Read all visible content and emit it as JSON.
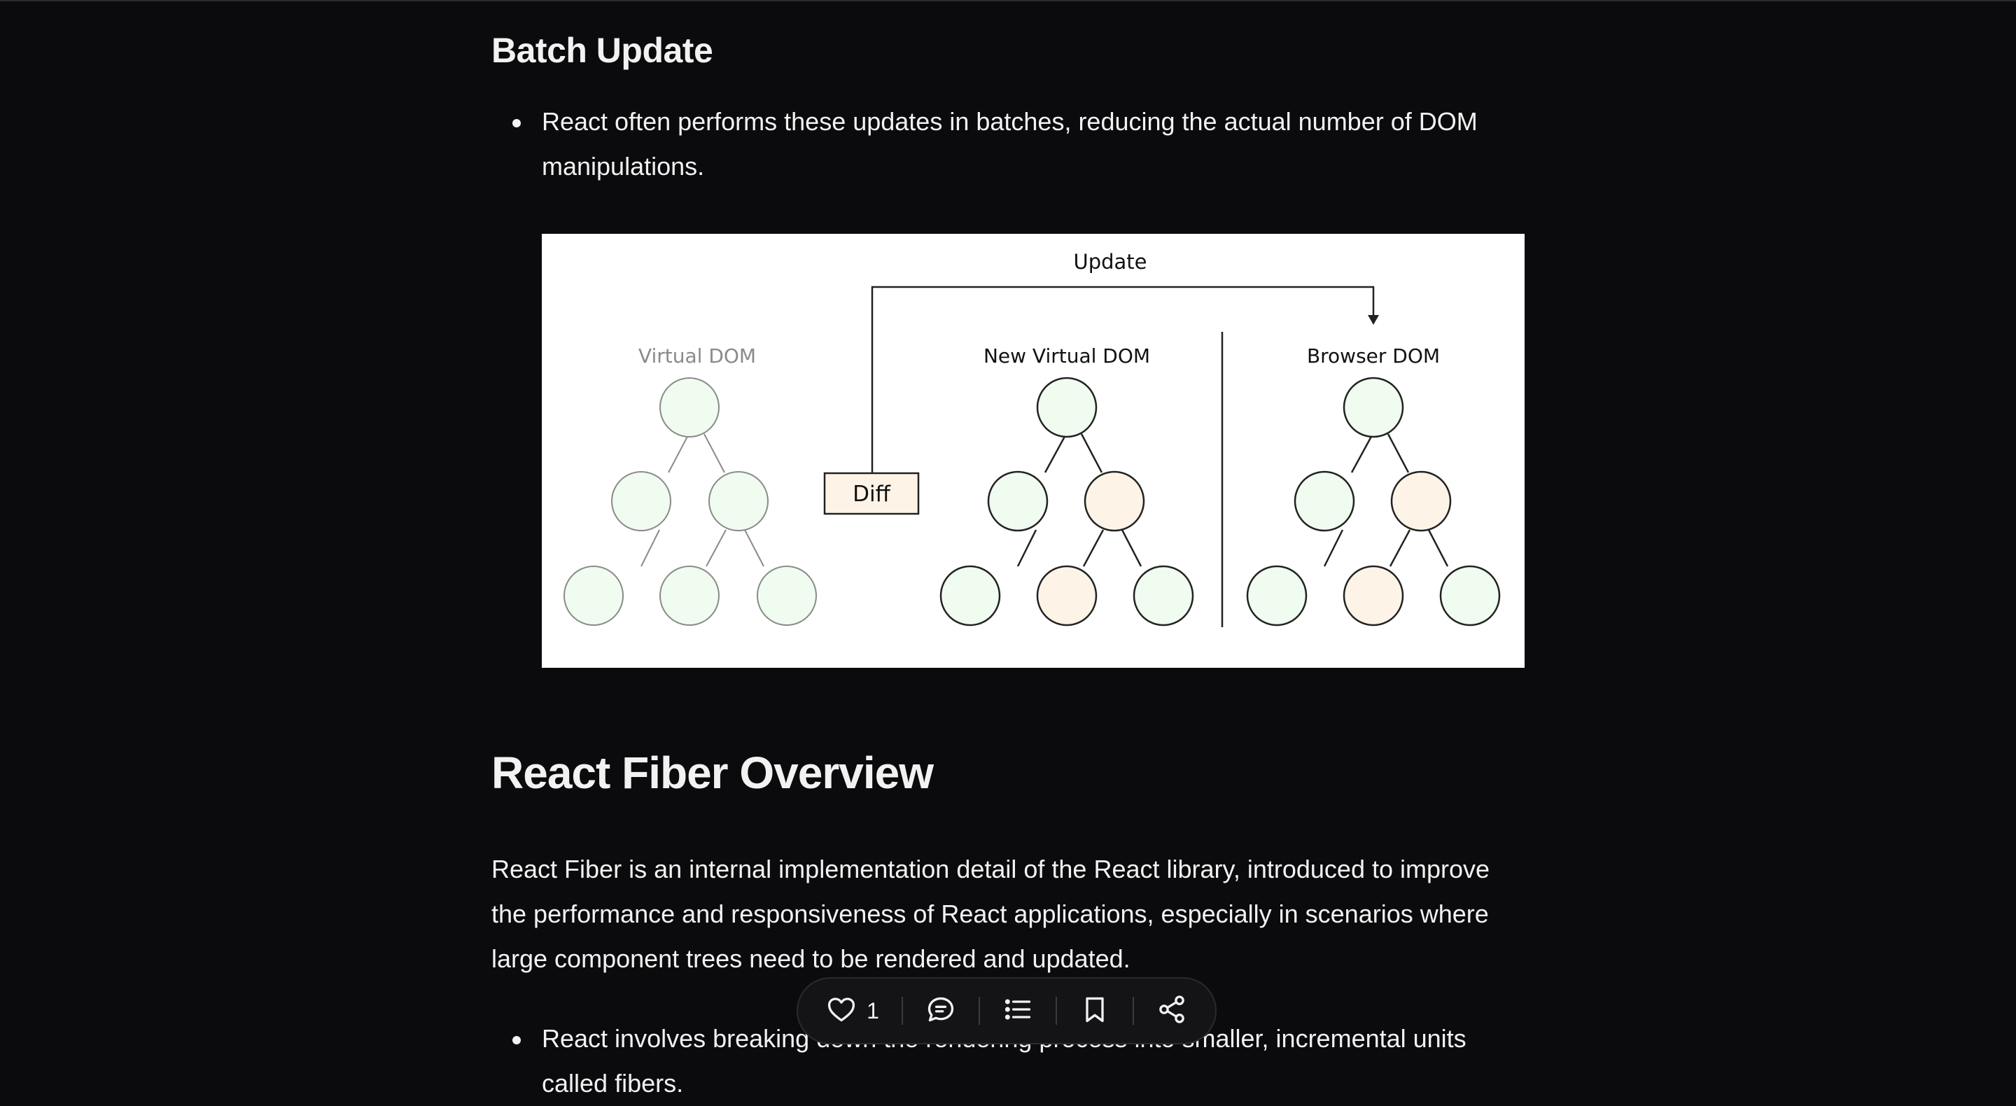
{
  "batch": {
    "title": "Batch Update",
    "bullet": "React often performs these updates in batches, reducing the actual number of DOM manipulations."
  },
  "diagram": {
    "update_label": "Update",
    "diff_label": "Diff",
    "virtual_dom_label": "Virtual DOM",
    "new_virtual_dom_label": "New Virtual DOM",
    "browser_dom_label": "Browser DOM",
    "colors": {
      "unchanged": "#effcef",
      "changed": "#fdf4e7"
    }
  },
  "fiber": {
    "title": "React Fiber Overview",
    "paragraph": "React Fiber is an internal implementation detail of the React library, introduced to improve the performance and responsiveness of React applications, especially in scenarios where large component trees need to be rendered and updated.",
    "bullet": "React involves breaking down the rendering process into smaller, incremental units called fibers."
  },
  "toolbar": {
    "like_icon": "heart-icon",
    "like_count": "1",
    "comment_icon": "comment-icon",
    "toc_icon": "list-icon",
    "bookmark_icon": "bookmark-icon",
    "share_icon": "share-icon"
  }
}
